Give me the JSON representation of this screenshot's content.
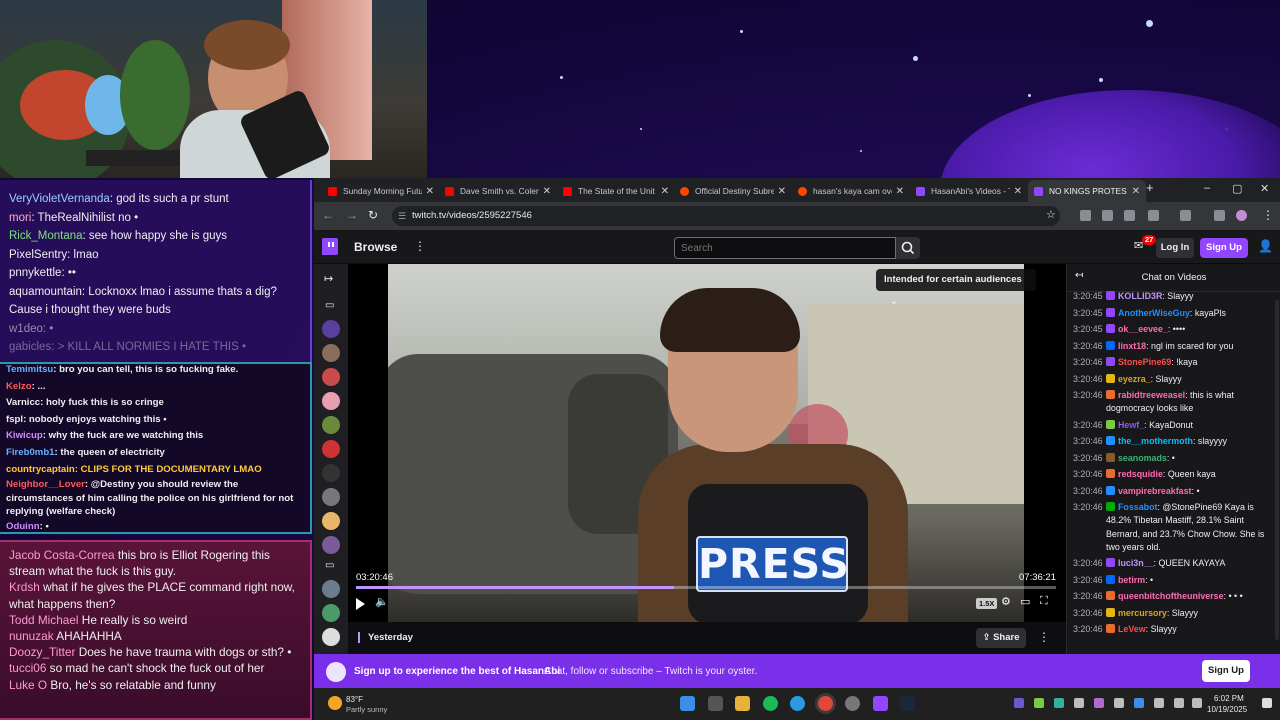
{
  "browser": {
    "tabs": [
      {
        "label": "Sunday Morning Futu",
        "favicon_color": "#ff0000"
      },
      {
        "label": "Dave Smith vs. Colem",
        "favicon_color": "#ff0000"
      },
      {
        "label": "The State of the Unit",
        "favicon_color": "#ff0000"
      },
      {
        "label": "Official Destiny Subre",
        "favicon_color": "#ff4500"
      },
      {
        "label": "hasan's kaya cam ove",
        "favicon_color": "#ff4500"
      },
      {
        "label": "HasanAbi's Videos - T",
        "favicon_color": "#9147ff"
      },
      {
        "label": "NO KINGS PROTES",
        "favicon_color": "#9147ff"
      }
    ],
    "url": "twitch.tv/videos/2595227546"
  },
  "twitch": {
    "browse": "Browse",
    "search_placeholder": "Search",
    "notifications": "27",
    "login": "Log In",
    "signup": "Sign Up",
    "player": {
      "audiences": "Intended for certain audiences",
      "press_text": "PRESS",
      "elapsed": "03:20:46",
      "duration": "07:36:21",
      "progress": 0.4547,
      "speed": "1.5X"
    },
    "date": "Yesterday",
    "share": "Share",
    "chat_title": "Chat on Videos",
    "chat": [
      {
        "ts": "3:20:45",
        "user": "KOLLID3R",
        "color": "#bf94ff",
        "text": ": Slayyy",
        "badge": "#9147ff"
      },
      {
        "ts": "3:20:45",
        "user": "AnotherWiseGuy",
        "color": "#1e90ff",
        "text": ": kayaPls",
        "badge": "#9147ff"
      },
      {
        "ts": "3:20:45",
        "user": "ok__eevee_",
        "color": "#ff69b4",
        "text": ": ••••",
        "badge": "#9147ff"
      },
      {
        "ts": "3:20:46",
        "user": "linxt18",
        "color": "#ff69b4",
        "text": ": ngl im scared for you",
        "badge": "#0066ff"
      },
      {
        "ts": "3:20:46",
        "user": "StonePine69",
        "color": "#ff4a4a",
        "text": ": !kaya",
        "badge": "#9147ff"
      },
      {
        "ts": "3:20:46",
        "user": "eyezra_",
        "color": "#daa520",
        "text": ": Slayyy",
        "badge": "#e7b416"
      },
      {
        "ts": "3:20:46",
        "user": "rabidtreeweasel",
        "color": "#ff69b4",
        "text": ": this is what dogmocracy looks like",
        "badge": "#e96c2f"
      },
      {
        "ts": "3:20:46",
        "user": "Hewf_",
        "color": "#8a5cf6",
        "text": ": KayaDonut",
        "badge": "#7bcb42"
      },
      {
        "ts": "3:20:46",
        "user": "the__mothermoth",
        "color": "#00bfff",
        "text": ": slayyyy",
        "badge": "#1e90ff"
      },
      {
        "ts": "3:20:46",
        "user": "seanomads",
        "color": "#3cb371",
        "text": ": •",
        "badge": "#8b5a2b"
      },
      {
        "ts": "3:20:46",
        "user": "redsquidie",
        "color": "#ff69b4",
        "text": ": Queen kaya",
        "badge": "#e96c2f"
      },
      {
        "ts": "3:20:46",
        "user": "vampirebreakfast",
        "color": "#ff69b4",
        "text": ": •",
        "badge": "#1e90ff"
      },
      {
        "ts": "3:20:46",
        "user": "Fossabot",
        "color": "#1e90ff",
        "text": ": @StonePine69 Kaya is 48.2% Tibetan Mastiff, 28.1% Saint Bernard, and 23.7% Chow Chow. She is two years old.",
        "badge": "#00ad03"
      },
      {
        "ts": "3:20:46",
        "user": "luci3n__",
        "color": "#bf94ff",
        "text": ": QUEEN KAYAYA",
        "badge": "#9147ff"
      },
      {
        "ts": "3:20:46",
        "user": "betirm",
        "color": "#ff69b4",
        "text": ": •",
        "badge": "#0066ff"
      },
      {
        "ts": "3:20:46",
        "user": "queenbitchoftheuniverse",
        "color": "#ff69b4",
        "text": ": • • •",
        "badge": "#e96c2f"
      },
      {
        "ts": "3:20:46",
        "user": "mercursory",
        "color": "#daa520",
        "text": ": Slayyy",
        "badge": "#e7b416"
      },
      {
        "ts": "3:20:46",
        "user": "LeVew",
        "color": "#ff4a4a",
        "text": ": Slayyy",
        "badge": "#e96c2f"
      }
    ],
    "promo": {
      "title": "Sign up to experience the best of HasanAbi",
      "subtitle": "Chat, follow or subscribe – Twitch is your oyster.",
      "button": "Sign Up"
    }
  },
  "overlay": {
    "chat1": [
      {
        "user": "VeryVioletVernanda",
        "color": "#9ad0ff",
        "text": ": god its such a pr stunt"
      },
      {
        "user": "mori",
        "color": "#ffb0d0",
        "text": ": TheRealNihilist no •"
      },
      {
        "user": "Rick_Montana",
        "color": "#7fe07f",
        "text": ": see how happy she is guys"
      },
      {
        "user": "PixelSentry",
        "color": "#d8d8e8",
        "text": ": lmao"
      },
      {
        "user": "pnnykettle",
        "color": "#d8d8e8",
        "text": ": ••"
      },
      {
        "user": "aquamountain",
        "color": "#d8d8e8",
        "text": ": Locknoxx lmao i assume thats a dig?"
      },
      {
        "user": "",
        "color": "#d8d8e8",
        "text": "Cause i thought they were buds"
      },
      {
        "user": "w1deo",
        "color": "#d8d8e8",
        "text": ": •"
      },
      {
        "user": "gabicles",
        "color": "#d8d8e8",
        "text": ": > KILL ALL NORMIES I HATE THIS •"
      }
    ],
    "chat2": [
      {
        "user": "Temimitsu",
        "color": "#6ab0ff",
        "text": ": bro you can tell, this is so fucking fake."
      },
      {
        "user": "Kelzo",
        "color": "#ff5a5a",
        "text": ": ..."
      },
      {
        "user": "Varnicc",
        "color": "#ffffff",
        "text": ": holy fuck this is so cringe"
      },
      {
        "user": "fspl",
        "color": "#ffffff",
        "text": ": nobody enjoys watching this •"
      },
      {
        "user": "Kiwicup",
        "color": "#d08aff",
        "text": ": why the fuck are we watching this"
      },
      {
        "user": "Fireb0mb1",
        "color": "#6ab0ff",
        "text": ": the queen of electricity"
      },
      {
        "user": "countrycaptain",
        "color": "#ffcc33",
        "text": ": CLIPS FOR THE DOCUMENTARY LMAO"
      },
      {
        "user": "Neighbor__Lover",
        "color": "#ff5a5a",
        "text": ": @Destiny you should review the circumstances of him calling the police on his girlfriend for not replying (welfare check)"
      },
      {
        "user": "Oduinn",
        "color": "#d08aff",
        "text": ": •"
      }
    ],
    "chat3": [
      {
        "user": "Jacob Costa-Correa",
        "color": "#ff9ad0",
        "text": " this bro is Elliot Rogering this stream what the fuck is this guy."
      },
      {
        "user": "Krdsh",
        "color": "#ff9ad0",
        "text": " what if he gives the PLACE command right now, what happens then?"
      },
      {
        "user": "Todd Michael",
        "color": "#ff9ad0",
        "text": " He really is so weird"
      },
      {
        "user": "nunuzak",
        "color": "#ff9ad0",
        "text": " AHAHAHHA"
      },
      {
        "user": "Doozy_Titter",
        "color": "#ff9ad0",
        "text": " Does he have trauma with dogs or sth? •"
      },
      {
        "user": "tucci06",
        "color": "#ff9ad0",
        "text": " so mad he can't shock the fuck out of her"
      },
      {
        "user": "Luke O",
        "color": "#ff9ad0",
        "text": " Bro, he's so relatable and funny"
      }
    ]
  },
  "taskbar": {
    "weather_temp": "83°F",
    "weather_desc": "Partly sunny",
    "time": "6:02 PM",
    "date": "10/19/2025"
  }
}
